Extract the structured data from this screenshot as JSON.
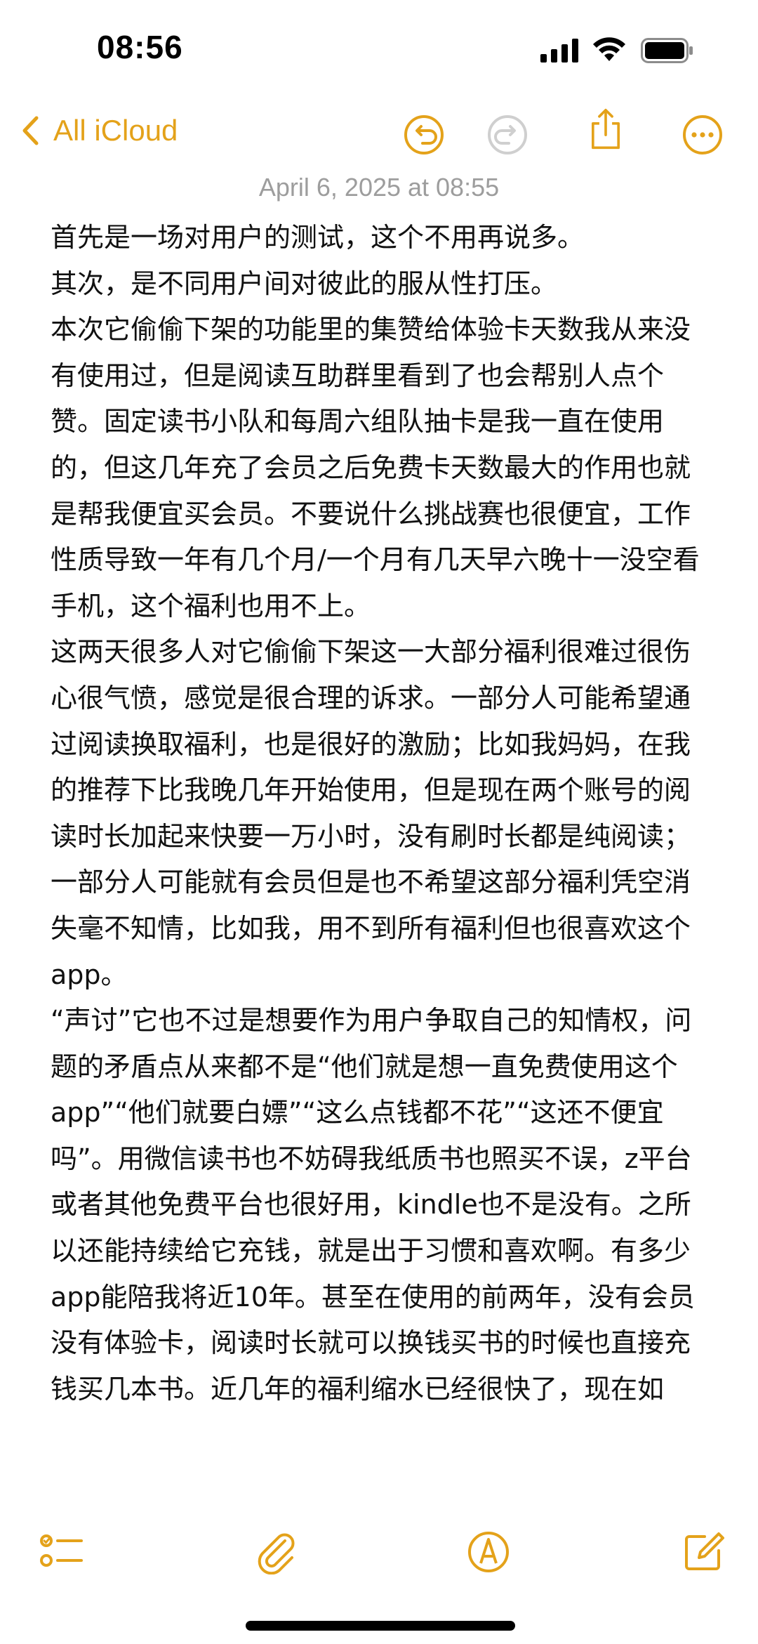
{
  "status_bar": {
    "time": "08:56"
  },
  "nav": {
    "back_label": "All iCloud",
    "accent_color": "#e4a21a",
    "icons": [
      "chevron-left-icon",
      "undo-icon",
      "redo-icon",
      "share-icon",
      "more-icon"
    ]
  },
  "note": {
    "date": "April 6, 2025 at 08:55",
    "paragraphs": [
      "首先是一场对用户的测试，这个不用再说多。",
      "其次，是不同用户间对彼此的服从性打压。",
      "本次它偷偷下架的功能里的集赞给体验卡天数我从来没有使用过，但是阅读互助群里看到了也会帮别人点个赞。固定读书小队和每周六组队抽卡是我一直在使用的，但这几年充了会员之后免费卡天数最大的作用也就是帮我便宜买会员。不要说什么挑战赛也很便宜，工作性质导致一年有几个月/一个月有几天早六晚十一没空看手机，这个福利也用不上。",
      "这两天很多人对它偷偷下架这一大部分福利很难过很伤心很气愤，感觉是很合理的诉求。一部分人可能希望通过阅读换取福利，也是很好的激励；比如我妈妈，在我的推荐下比我晚几年开始使用，但是现在两个账号的阅读时长加起来快要一万小时，没有刷时长都是纯阅读；一部分人可能就有会员但是也不希望这部分福利凭空消失毫不知情，比如我，用不到所有福利但也很喜欢这个app。",
      "“声讨”它也不过是想要作为用户争取自己的知情权，问题的矛盾点从来都不是“他们就是想一直免费使用这个app”“他们就要白嫖”“这么点钱都不花”“这还不便宜吗”。用微信读书也不妨碍我纸质书也照买不误，z平台或者其他免费平台也很好用，kindle也不是没有。之所以还能持续给它充钱，就是出于习惯和喜欢啊。有多少app能陪我将近10年。甚至在使用的前两年，没有会员没有体验卡，阅读时长就可以换钱买书的时候也直接充钱买几本书。近几年的福利缩水已经很快了，现在如"
    ]
  },
  "toolbar": {
    "icons": [
      "checklist-icon",
      "attachment-icon",
      "markup-icon",
      "compose-icon"
    ]
  }
}
